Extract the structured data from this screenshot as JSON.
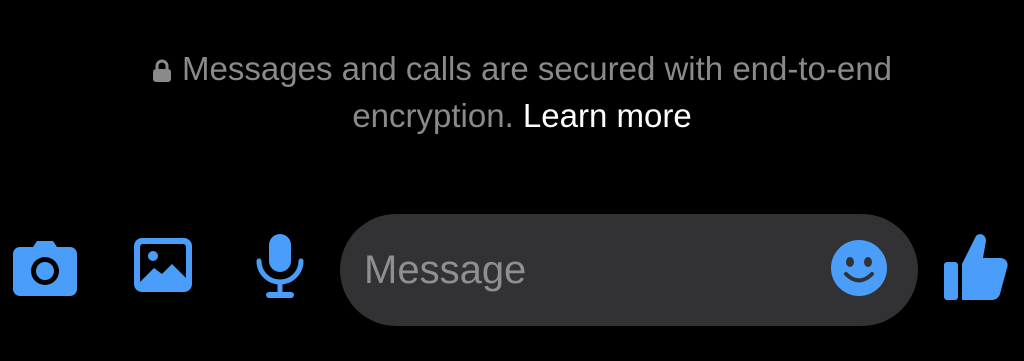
{
  "notice": {
    "text": "Messages and calls are secured with end-to-end encryption.",
    "link_label": "Learn more",
    "lock_icon": "lock-icon"
  },
  "composer": {
    "placeholder": "Message",
    "value": "",
    "buttons": [
      {
        "name": "camera",
        "icon": "camera-icon"
      },
      {
        "name": "gallery",
        "icon": "image-icon"
      },
      {
        "name": "voice",
        "icon": "microphone-icon"
      },
      {
        "name": "emoji",
        "icon": "smiley-icon"
      },
      {
        "name": "like",
        "icon": "thumbs-up-icon"
      }
    ]
  },
  "colors": {
    "background": "#000000",
    "accent": "#4a9df8",
    "muted_text": "#8a8a8d",
    "link_text": "#ffffff",
    "input_bg": "#323234"
  }
}
